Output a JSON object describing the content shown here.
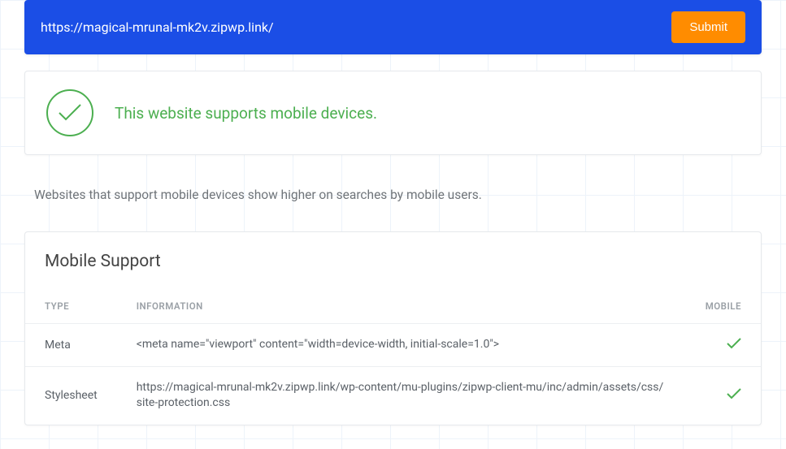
{
  "url_bar": {
    "url": "https://magical-mrunal-mk2v.zipwp.link/",
    "submit_label": "Submit"
  },
  "status": {
    "message": "This website supports mobile devices."
  },
  "description": "Websites that support mobile devices show higher on searches by mobile users.",
  "table": {
    "title": "Mobile Support",
    "headers": {
      "type": "TYPE",
      "information": "INFORMATION",
      "mobile": "MOBILE"
    },
    "rows": [
      {
        "type": "Meta",
        "information": "<meta name=\"viewport\" content=\"width=device-width, initial-scale=1.0\">",
        "mobile": true
      },
      {
        "type": "Stylesheet",
        "information": "https://magical-mrunal-mk2v.zipwp.link/wp-content/mu-plugins/zipwp-client-mu/inc/admin/assets/css/site-protection.css",
        "mobile": true
      }
    ]
  }
}
